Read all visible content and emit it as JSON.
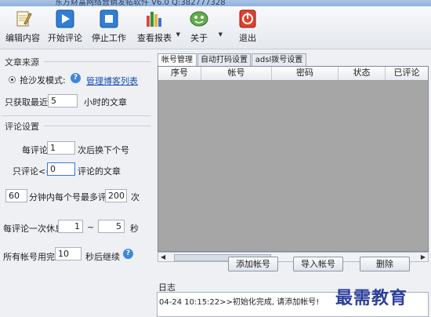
{
  "window": {
    "title": "东方财富网络营销发帖软件 V6.0 Q:382777328"
  },
  "toolbar": {
    "items": [
      {
        "label": "编辑内容",
        "icon": "edit-icon"
      },
      {
        "label": "开始评论",
        "icon": "play-icon"
      },
      {
        "label": "停止工作",
        "icon": "stop-icon"
      },
      {
        "label": "查看报表",
        "icon": "report-icon"
      },
      {
        "label": "关于",
        "icon": "about-icon"
      },
      {
        "label": "退出",
        "icon": "exit-icon"
      }
    ]
  },
  "source": {
    "title": "文章来源",
    "mode_label": "抢沙发模式:",
    "manage_link": "管理博客列表",
    "fetch_prefix": "只获取最近",
    "fetch_hours": "5",
    "fetch_suffix": "小时的文章"
  },
  "comment": {
    "title": "评论设置",
    "every_label": "每评论",
    "every_value": "1",
    "every_suffix": "次后换下个号",
    "only_label": "只评论<=",
    "only_value": "0",
    "only_suffix": "评论的文章",
    "minutes_value": "60",
    "minutes_label": "分钟内每个号最多评论",
    "max_value": "200",
    "max_suffix": "次",
    "rest_label": "每评论一次休息",
    "rest_min": "1",
    "rest_sep": "~",
    "rest_max": "5",
    "rest_unit": "秒",
    "all_used_label": "所有帐号用完",
    "all_used_value": "10",
    "all_used_suffix": "秒后继续"
  },
  "tabs": [
    "帐号管理",
    "自动打码设置",
    "adsl拨号设置"
  ],
  "grid": {
    "columns": [
      "序号",
      "帐号",
      "密码",
      "状态",
      "已评论"
    ]
  },
  "buttons": {
    "add": "添加帐号",
    "import": "导入帐号",
    "delete": "删除"
  },
  "log": {
    "title": "日志",
    "line": "04-24 10:15:22>>初始化完成, 请添加帐号!"
  },
  "watermark": "最需教育"
}
